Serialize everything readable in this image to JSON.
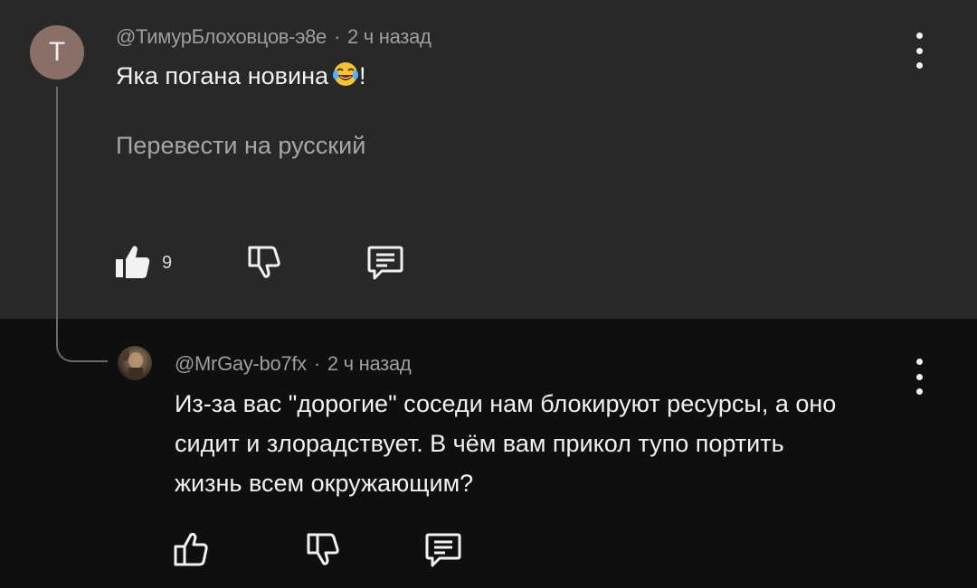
{
  "comment": {
    "avatar_letter": "Т",
    "author": "@ТимурБлоховцов-э8е",
    "time": "2 ч назад",
    "text": "Яка погана новина",
    "text_suffix": "!",
    "emoji_icon": "laughing-tears-emoji",
    "translate_label": "Перевести на русский",
    "like_count": "9"
  },
  "reply": {
    "author": "@MrGay-bo7fx",
    "time": "2 ч назад",
    "text_lines": [
      "Из-за вас \"дорогие\" соседи нам блокируют ресурсы, а оно",
      "сидит и злорадствует. В чём вам прикол тупо портить",
      "жизнь всем окружающим?"
    ]
  },
  "meta_separator": "·",
  "colors": {
    "top_bg": "#282828",
    "reply_bg": "#0f0f0f",
    "avatar_bg": "#8a6f69",
    "meta_text": "#9e9e9e"
  }
}
